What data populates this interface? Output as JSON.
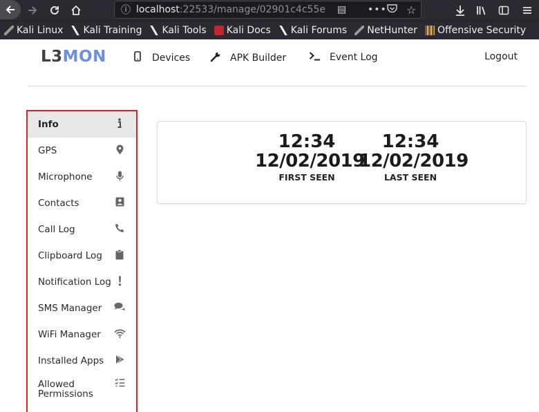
{
  "browser": {
    "url_host": "localhost",
    "url_path_visible": ":22533/manage/02901c4c55e",
    "bookmarks": [
      {
        "label": "Kali Linux",
        "icon": "kali-dragon-icon"
      },
      {
        "label": "Kali Training",
        "icon": "kali-slash-icon"
      },
      {
        "label": "Kali Tools",
        "icon": "kali-slash-icon"
      },
      {
        "label": "Kali Docs",
        "icon": "kali-docs-icon"
      },
      {
        "label": "Kali Forums",
        "icon": "kali-slash-icon"
      },
      {
        "label": "NetHunter",
        "icon": "kali-dragon-icon"
      },
      {
        "label": "Offensive Security",
        "icon": "offsec-icon"
      }
    ]
  },
  "navbar": {
    "brand_l3": "L3",
    "brand_mon": "MON",
    "devices": "Devices",
    "apk_builder": "APK Builder",
    "event_log": "Event Log",
    "logout": "Logout"
  },
  "sidebar": {
    "items": [
      {
        "label": "Info",
        "icon": "info-icon"
      },
      {
        "label": "GPS",
        "icon": "map-marker-icon"
      },
      {
        "label": "Microphone",
        "icon": "microphone-icon"
      },
      {
        "label": "Contacts",
        "icon": "address-book-icon"
      },
      {
        "label": "Call Log",
        "icon": "phone-icon"
      },
      {
        "label": "Clipboard Log",
        "icon": "clipboard-icon"
      },
      {
        "label": "Notification Log",
        "icon": "exclamation-icon"
      },
      {
        "label": "SMS Manager",
        "icon": "comments-icon"
      },
      {
        "label": "WiFi Manager",
        "icon": "wifi-icon"
      },
      {
        "label": "Installed Apps",
        "icon": "play-store-icon"
      },
      {
        "label": "Allowed Permissions",
        "icon": "tasks-icon"
      }
    ]
  },
  "device": {
    "first_seen_time": "12:34",
    "first_seen_date": "12/02/2019",
    "first_seen_label": "FIRST SEEN",
    "last_seen_time": "12:34",
    "last_seen_date": "12/02/2019",
    "last_seen_label": "LAST SEEN"
  },
  "colors": {
    "brand_accent": "#6f8fd8",
    "sidebar_highlight_border": "#e0202c",
    "browser_chrome": "#2b2a33"
  }
}
